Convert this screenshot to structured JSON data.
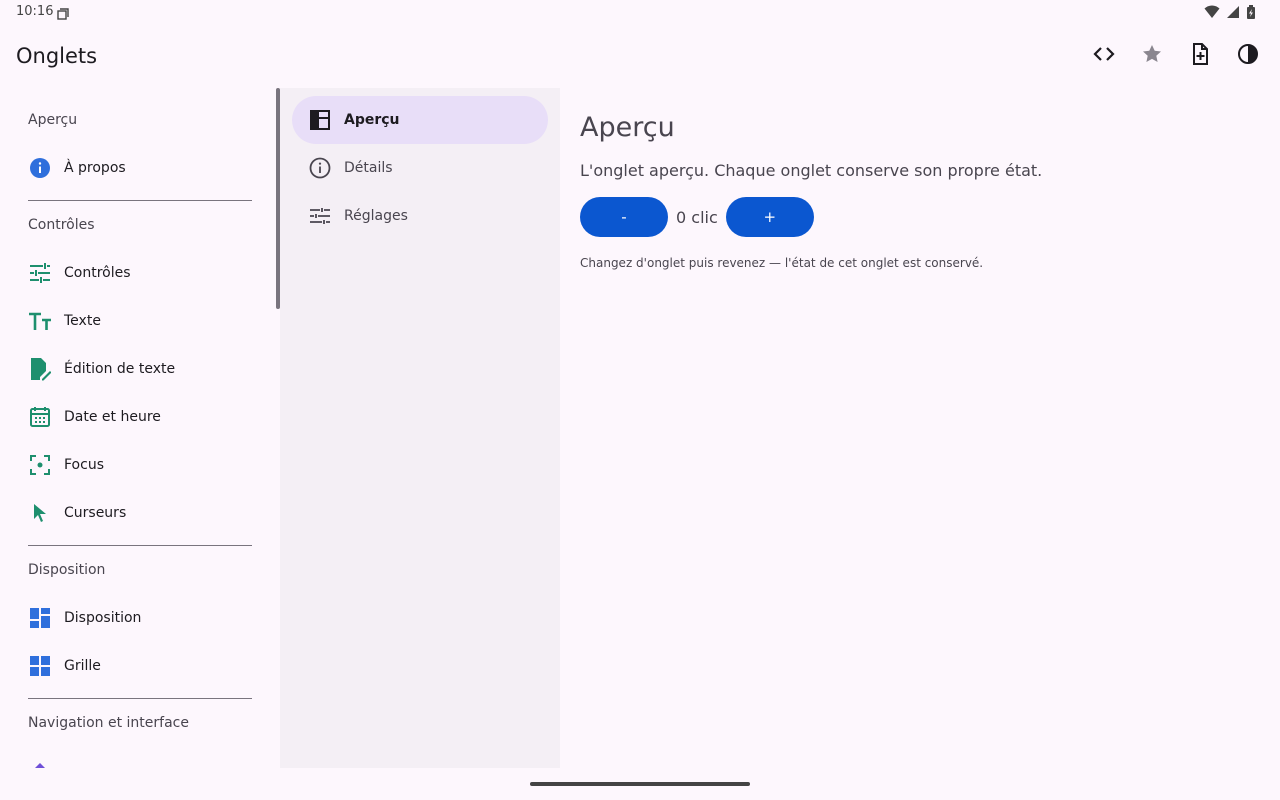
{
  "status": {
    "time": "10:16"
  },
  "app": {
    "title": "Onglets"
  },
  "actions": [
    "code-icon",
    "star-icon",
    "new-file-icon",
    "contrast-icon"
  ],
  "nav": {
    "sections": [
      "Aperçu",
      "Contrôles",
      "Disposition",
      "Navigation et interface"
    ],
    "items": [
      {
        "label": "À propos",
        "icon": "info-icon"
      },
      {
        "label": "Contrôles",
        "icon": "tune-icon"
      },
      {
        "label": "Texte",
        "icon": "text-fields-icon"
      },
      {
        "label": "Édition de texte",
        "icon": "edit-document-icon"
      },
      {
        "label": "Date et heure",
        "icon": "calendar-icon"
      },
      {
        "label": "Focus",
        "icon": "focus-icon"
      },
      {
        "label": "Curseurs",
        "icon": "cursor-icon"
      },
      {
        "label": "Disposition",
        "icon": "dashboard-icon"
      },
      {
        "label": "Grille",
        "icon": "grid-icon"
      }
    ]
  },
  "tabs": [
    {
      "label": "Aperçu",
      "icon": "dashboard-icon",
      "active": true
    },
    {
      "label": "Détails",
      "icon": "info-outline-icon",
      "active": false
    },
    {
      "label": "Réglages",
      "icon": "settings-sliders-icon",
      "active": false
    }
  ],
  "content": {
    "title": "Aperçu",
    "description": "L'onglet aperçu. Chaque onglet conserve son propre état.",
    "minus_label": "-",
    "plus_label": "+",
    "counter": "0 clic",
    "note": "Changez d'onglet puis revenez — l'état de cet onglet est conservé."
  },
  "colors": {
    "accent": "#0b57d0",
    "icon_green": "#1e8f6e",
    "icon_blue": "#2f6fdc",
    "tab_active": "#e8def8"
  }
}
